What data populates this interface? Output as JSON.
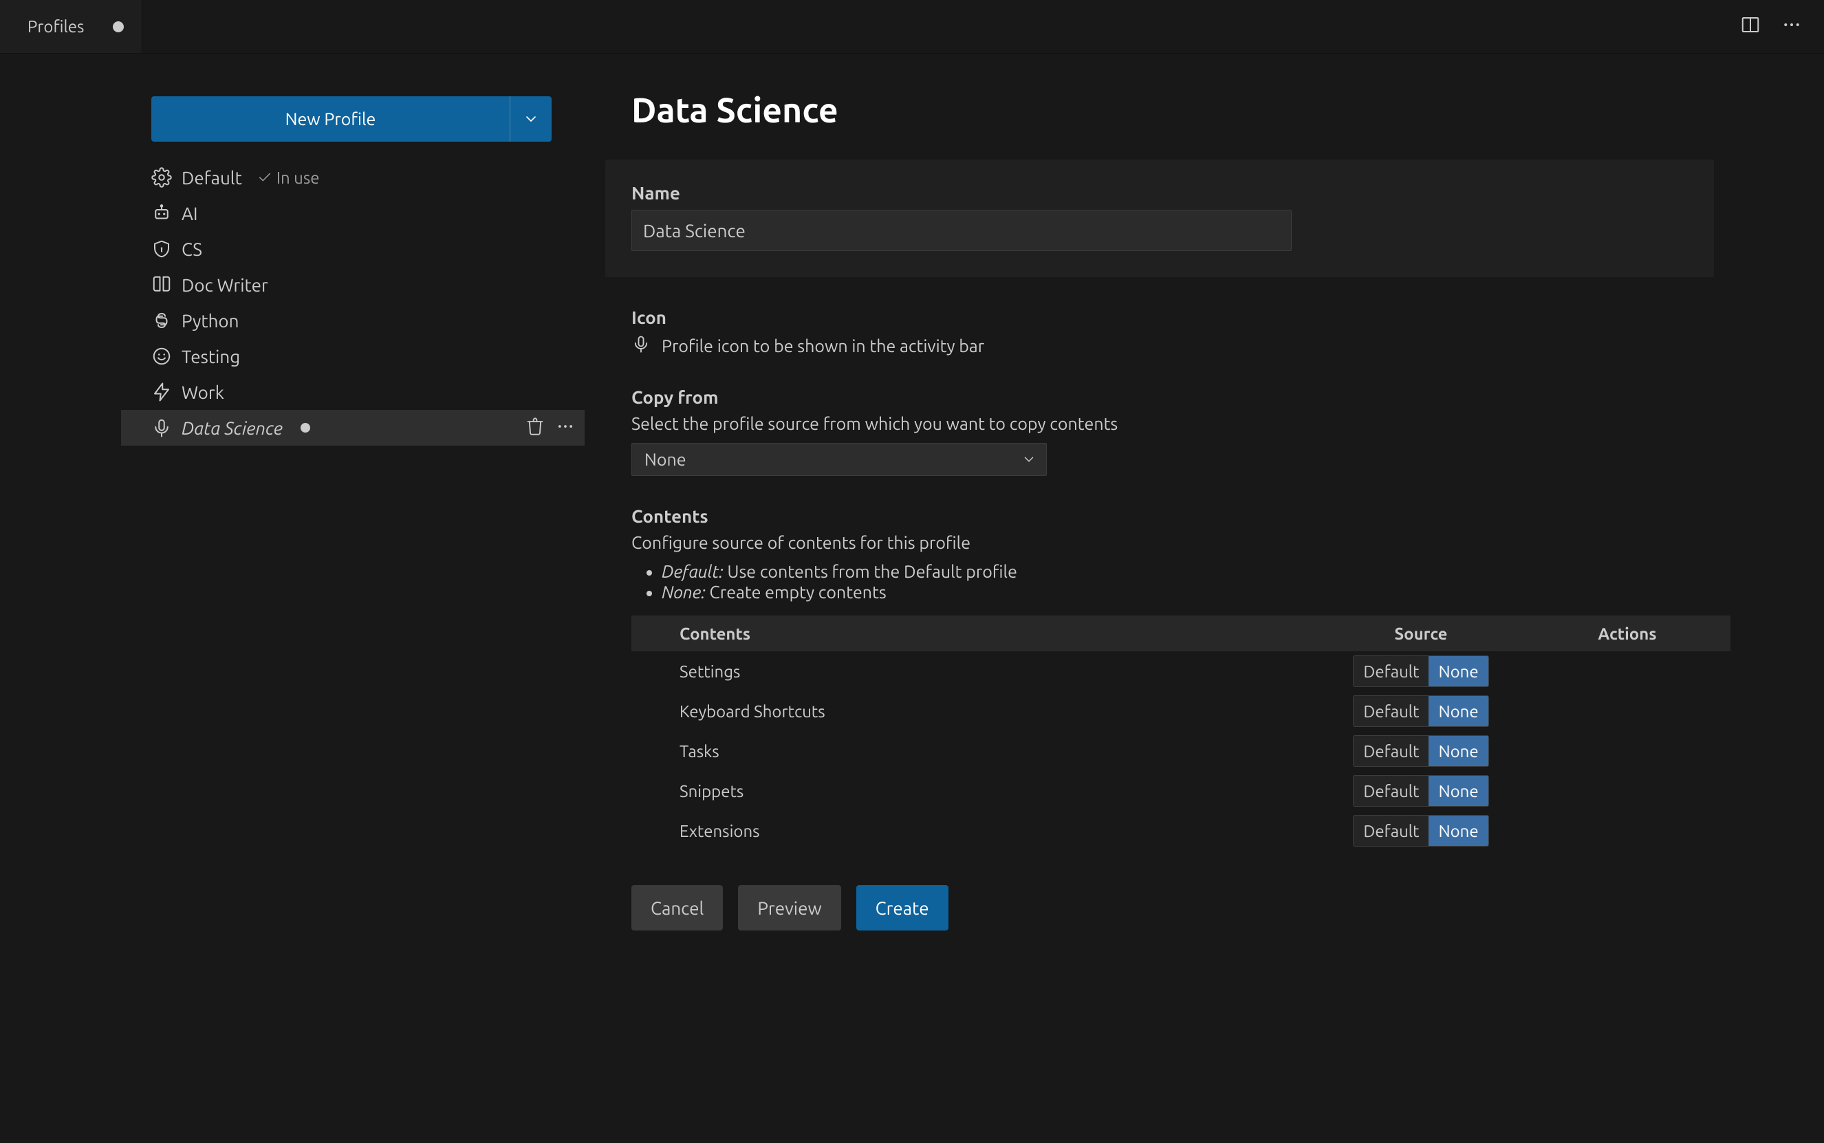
{
  "tab": {
    "title": "Profiles",
    "dirty": true
  },
  "sidebar": {
    "new_profile_label": "New Profile",
    "items": [
      {
        "icon": "gear",
        "name": "Default",
        "in_use": true
      },
      {
        "icon": "robot",
        "name": "AI"
      },
      {
        "icon": "shield",
        "name": "CS"
      },
      {
        "icon": "book",
        "name": "Doc Writer"
      },
      {
        "icon": "snake",
        "name": "Python"
      },
      {
        "icon": "smile",
        "name": "Testing"
      },
      {
        "icon": "bolt",
        "name": "Work"
      },
      {
        "icon": "mic",
        "name": "Data Science",
        "selected": true,
        "unsaved": true
      }
    ],
    "in_use_label": "In use"
  },
  "editor": {
    "title": "Data Science",
    "name_section": {
      "label": "Name",
      "value": "Data Science"
    },
    "icon_section": {
      "label": "Icon",
      "description": "Profile icon to be shown in the activity bar"
    },
    "copy_from_section": {
      "label": "Copy from",
      "description": "Select the profile source from which you want to copy contents",
      "selected": "None"
    },
    "contents_section": {
      "label": "Contents",
      "description": "Configure source of contents for this profile",
      "bullets": [
        {
          "term": "Default:",
          "text": "Use contents from the Default profile"
        },
        {
          "term": "None:",
          "text": "Create empty contents"
        }
      ],
      "table": {
        "headers": [
          "Contents",
          "Source",
          "Actions"
        ],
        "source_options": [
          "Default",
          "None"
        ],
        "rows": [
          {
            "name": "Settings",
            "source": "None"
          },
          {
            "name": "Keyboard Shortcuts",
            "source": "None"
          },
          {
            "name": "Tasks",
            "source": "None"
          },
          {
            "name": "Snippets",
            "source": "None"
          },
          {
            "name": "Extensions",
            "source": "None"
          }
        ]
      }
    },
    "buttons": {
      "cancel": "Cancel",
      "preview": "Preview",
      "create": "Create"
    }
  }
}
